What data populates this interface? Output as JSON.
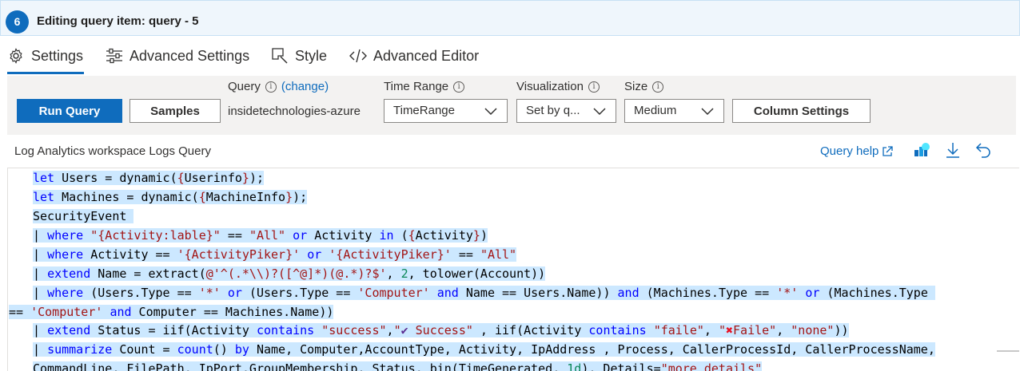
{
  "header": {
    "step_number": "6",
    "title": "Editing query item: query - 5"
  },
  "tabs": [
    {
      "label": "Settings",
      "icon": "gear-icon",
      "active": true
    },
    {
      "label": "Advanced Settings",
      "icon": "sliders-icon",
      "active": false
    },
    {
      "label": "Style",
      "icon": "brush-icon",
      "active": false
    },
    {
      "label": "Advanced Editor",
      "icon": "code-icon",
      "active": false
    }
  ],
  "toolbar": {
    "run_query_label": "Run Query",
    "samples_label": "Samples",
    "query_label": "Query",
    "query_change_link": "(change)",
    "query_value": "insidetechnologies-azure",
    "time_range_label": "Time Range",
    "time_range_value": "TimeRange",
    "visualization_label": "Visualization",
    "visualization_value": "Set by q...",
    "size_label": "Size",
    "size_value": "Medium",
    "column_settings_label": "Column Settings"
  },
  "editor": {
    "header_label": "Log Analytics workspace Logs Query",
    "query_help_label": "Query help",
    "tool_icons": [
      "external-link-icon",
      "pin-to-dashboard-icon",
      "download-icon",
      "undo-icon"
    ]
  },
  "colors": {
    "accent": "#0f6cbd",
    "selection": "#cce8ff",
    "header_bg": "#eff6fc"
  }
}
